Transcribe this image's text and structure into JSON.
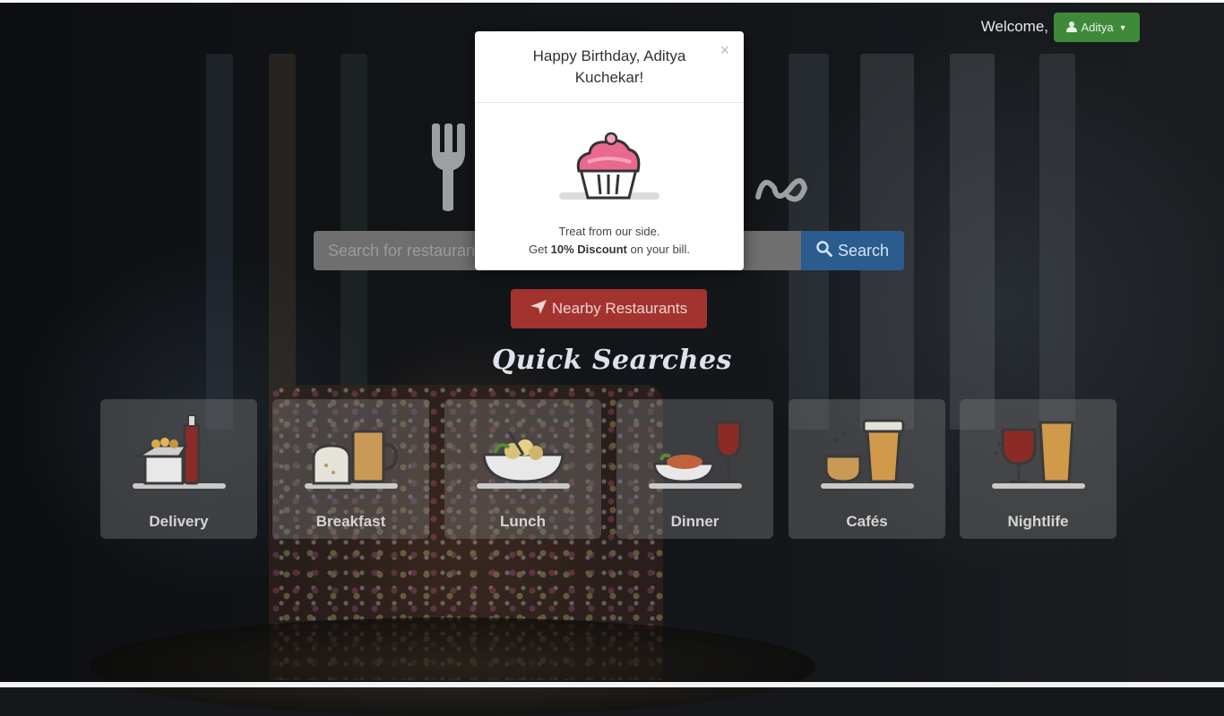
{
  "header": {
    "welcome_text": "Welcome,",
    "user_name": "Aditya",
    "user_icon": "user-icon",
    "caret_icon": "caret-down-icon"
  },
  "search": {
    "placeholder": "Search for restaurants",
    "button_label": "Search",
    "button_icon": "search-icon"
  },
  "nearby": {
    "label": "Nearby Restaurants",
    "icon": "location-arrow-icon"
  },
  "quick_searches": {
    "title": "Quick Searches",
    "items": [
      {
        "label": "Delivery",
        "icon": "delivery-icon"
      },
      {
        "label": "Breakfast",
        "icon": "breakfast-icon"
      },
      {
        "label": "Lunch",
        "icon": "lunch-icon"
      },
      {
        "label": "Dinner",
        "icon": "dinner-icon"
      },
      {
        "label": "Cafés",
        "icon": "cafe-icon"
      },
      {
        "label": "Nightlife",
        "icon": "nightlife-icon"
      }
    ]
  },
  "modal": {
    "title": "Happy Birthday, Aditya Kuchekar!",
    "close_label": "×",
    "line1": "Treat from our side.",
    "line2_prefix": "Get ",
    "line2_bold": "10% Discount",
    "line2_suffix": " on your bill."
  },
  "colors": {
    "user_button": "#3e8a3a",
    "search_button": "#2b5c90",
    "nearby_button": "#a2332f",
    "cupcake_frosting": "#e96a8e"
  }
}
